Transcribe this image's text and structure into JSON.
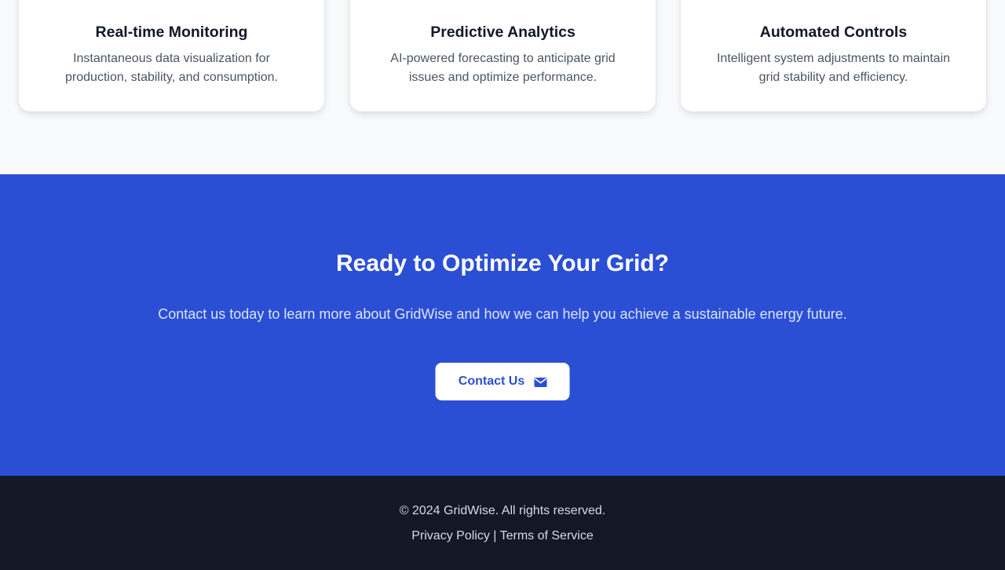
{
  "features": {
    "cards": [
      {
        "icon": "monitor-icon",
        "title": "Real-time Monitoring",
        "description": "Instantaneous data visualization for production, stability, and consumption."
      },
      {
        "icon": "shield-check-icon",
        "title": "Predictive Analytics",
        "description": "AI-powered forecasting to anticipate grid issues and optimize performance."
      },
      {
        "icon": "robot-icon",
        "title": "Automated Controls",
        "description": "Intelligent system adjustments to maintain grid stability and efficiency."
      }
    ]
  },
  "cta": {
    "title": "Ready to Optimize Your Grid?",
    "text": "Contact us today to learn more about GridWise and how we can help you achieve a sustainable energy future.",
    "button_label": "Contact Us",
    "button_icon": "envelope-icon"
  },
  "footer": {
    "copyright": "© 2024 GridWise. All rights reserved.",
    "privacy_label": "Privacy Policy",
    "separator": "|",
    "terms_label": "Terms of Service"
  },
  "colors": {
    "primary": "#2b4fd4",
    "page_background": "#f8fafc",
    "footer_background": "#121826",
    "monitor_icon": "#3b63e0",
    "analytics_icon": "#3fa45a",
    "controls_icon": "#2f9a8a"
  }
}
